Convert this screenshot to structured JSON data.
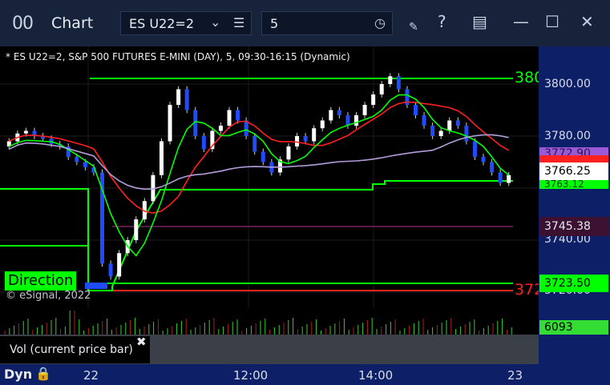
{
  "window": {
    "title": "Chart",
    "app_icon": "00",
    "symbol": "ES U22=2",
    "interval": "5",
    "icons": [
      "chevron-down-icon",
      "list-icon",
      "clock-icon",
      "pen-icon",
      "help-icon",
      "layout-icon",
      "maximize-icon",
      "close-icon"
    ]
  },
  "chart": {
    "header": "* ES U22=2, S&P 500 FUTURES E-MINI (DAY), 5, 09:30-16:15 (Dynamic)",
    "direction_label": "Direction",
    "copyright": "© eSignal, 2022",
    "top_line_label": "380",
    "bottom_line_label": "372",
    "colors": {
      "up": "#ffffff",
      "down": "#1f4cff",
      "ma_fast": "#00ff00",
      "ma_slow": "#ff2020",
      "ma_long": "#b39ddb"
    }
  },
  "price_axis": {
    "ticks": [
      "3800.00",
      "3780.00",
      "3740.00",
      "3720.00"
    ],
    "labels": [
      {
        "text": "3772.90",
        "bg": "#9b59d8",
        "fg": "#2a1a4a"
      },
      {
        "text": "3766.25",
        "bg": "#ffffff",
        "fg": "#000000"
      },
      {
        "text": "3763.12",
        "bg": "#00ff00",
        "fg": "#0a3a0a"
      },
      {
        "text": "3745.38",
        "bg": "#3b1030",
        "fg": "#e6e9ef"
      },
      {
        "text": "3723.50",
        "bg": "#00ff00",
        "fg": "#000000"
      },
      {
        "text": "6093",
        "bg": "#33dd33",
        "fg": "#000000"
      }
    ]
  },
  "volume": {
    "label": "Vol (current price bar)"
  },
  "time_axis": {
    "mode": "Dyn",
    "labels": [
      "22",
      "12:00",
      "14:00",
      "23"
    ]
  }
}
